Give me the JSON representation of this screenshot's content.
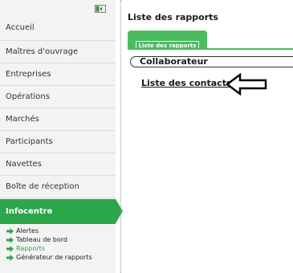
{
  "sidebar": {
    "nav_items": [
      {
        "label": "Accueil"
      },
      {
        "label": "Maîtres d'ouvrage"
      },
      {
        "label": "Entreprises"
      },
      {
        "label": "Opérations"
      },
      {
        "label": "Marchés"
      },
      {
        "label": "Participants"
      },
      {
        "label": "Navettes"
      },
      {
        "label": "Boîte de réception"
      }
    ],
    "active_item": {
      "label": "Infocentre"
    },
    "sub_items": [
      {
        "label": "Alertes"
      },
      {
        "label": "Tableau de bord"
      },
      {
        "label": "Rapports"
      },
      {
        "label": "Générateur de rapports"
      }
    ]
  },
  "main": {
    "page_title": "Liste des rapports",
    "tab_label": "Liste des rapports",
    "section_header": "Collaborateur",
    "link_label": "Liste des contacts"
  },
  "colors": {
    "accent": "#2ba64a",
    "tab_green": "#4cbb5f",
    "sidebar_bg": "#f3f3f3"
  },
  "icons": {
    "collapse": "collapse-sidebar-icon",
    "sub_item": "green-arrow-icon",
    "annotation": "left-pointing-arrow-icon"
  }
}
